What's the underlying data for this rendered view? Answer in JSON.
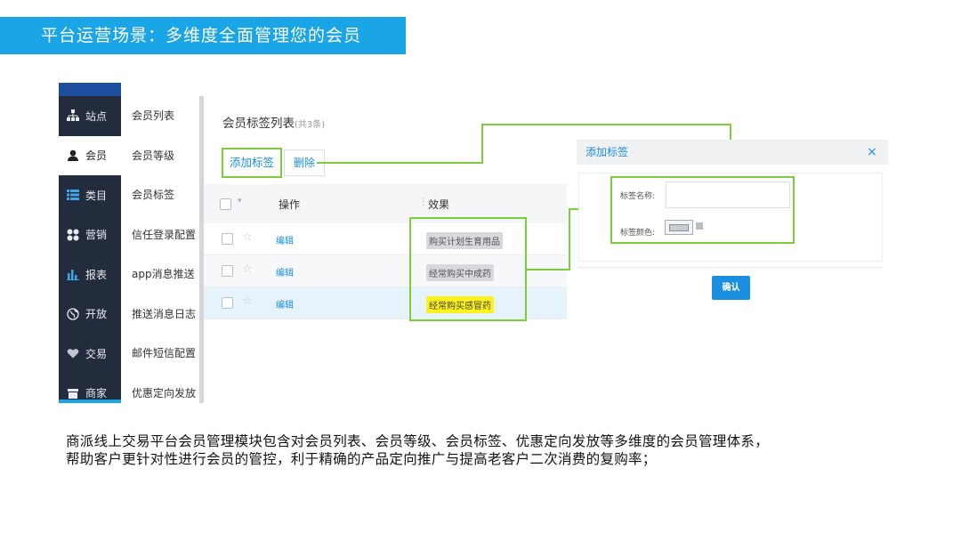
{
  "header": {
    "title": "平台运营场景：多维度全面管理您的会员"
  },
  "nav": {
    "items": [
      {
        "label": "站点",
        "icon": "sitemap-icon"
      },
      {
        "label": "会员",
        "icon": "user-icon"
      },
      {
        "label": "类目",
        "icon": "list-icon"
      },
      {
        "label": "营销",
        "icon": "grid-icon"
      },
      {
        "label": "报表",
        "icon": "bar-chart-icon"
      },
      {
        "label": "开放",
        "icon": "globe-icon"
      },
      {
        "label": "交易",
        "icon": "heart-icon"
      },
      {
        "label": "商家",
        "icon": "shop-icon"
      }
    ]
  },
  "subnav": {
    "items": [
      "会员列表",
      "会员等级",
      "会员标签",
      "信任登录配置",
      "app消息推送",
      "推送消息日志",
      "邮件短信配置",
      "优惠定向发放"
    ]
  },
  "list": {
    "title": "会员标签列表",
    "count": "(共3条)",
    "add_label": "添加标签",
    "delete_label": "删除",
    "columns": [
      "操作",
      "效果"
    ],
    "rows": [
      {
        "action": "编辑",
        "tag": "购买计划生育用品"
      },
      {
        "action": "编辑",
        "tag": "经常购买中成药"
      },
      {
        "action": "编辑",
        "tag": "经常购买感冒药"
      }
    ]
  },
  "dialog": {
    "title": "添加标签",
    "close": "×",
    "name_label": "标签名称:",
    "name_value": "",
    "color_label": "标签颜色:",
    "confirm_label": "确认"
  },
  "description": {
    "line1": "商派线上交易平台会员管理模块包含对会员列表、会员等级、会员标签、优惠定向发放等多维度的会员管理体系，",
    "line2": "帮助客户更针对性进行会员的管控，利于精确的产品定向推广与提高老客户二次消费的复购率；"
  },
  "colors": {
    "accent": "#1aa5e6",
    "nav_bg": "#232c3d",
    "highlight": "#7ccd3b",
    "link": "#1a8fe0",
    "tag_yellow": "#fdf21a"
  }
}
